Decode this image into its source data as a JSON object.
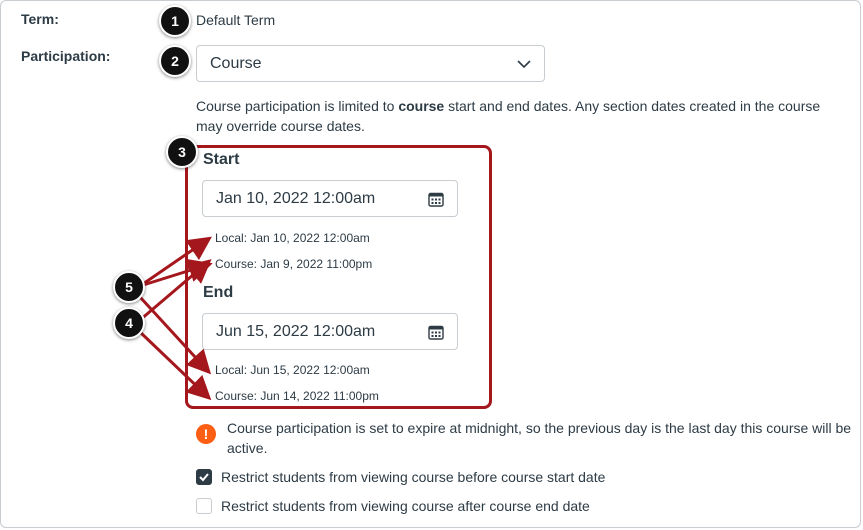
{
  "term": {
    "label": "Term:",
    "value": "Default Term"
  },
  "participation": {
    "label": "Participation:",
    "selected": "Course",
    "description_pre": "Course participation is limited to ",
    "description_bold": "course",
    "description_post": " start and end dates. Any section dates created in the course may override course dates."
  },
  "start": {
    "heading": "Start",
    "input_value": "Jan 10, 2022 12:00am",
    "local": "Local: Jan 10, 2022 12:00am",
    "course": "Course: Jan 9, 2022 11:00pm"
  },
  "end": {
    "heading": "End",
    "input_value": "Jun 15, 2022 12:00am",
    "local": "Local: Jun 15, 2022 12:00am",
    "course": "Course: Jun 14, 2022 11:00pm"
  },
  "warning": {
    "icon": "exclamation-icon",
    "text": "Course participation is set to expire at midnight, so the previous day is the last day this course will be active."
  },
  "checkboxes": [
    {
      "label": "Restrict students from viewing course before course start date",
      "checked": true
    },
    {
      "label": "Restrict students from viewing course after course end date",
      "checked": false
    }
  ],
  "badges": [
    "1",
    "2",
    "3",
    "4",
    "5"
  ],
  "colors": {
    "annotation_red": "#a4171d",
    "warning_orange": "#fc5e13",
    "text": "#2d3b45"
  }
}
